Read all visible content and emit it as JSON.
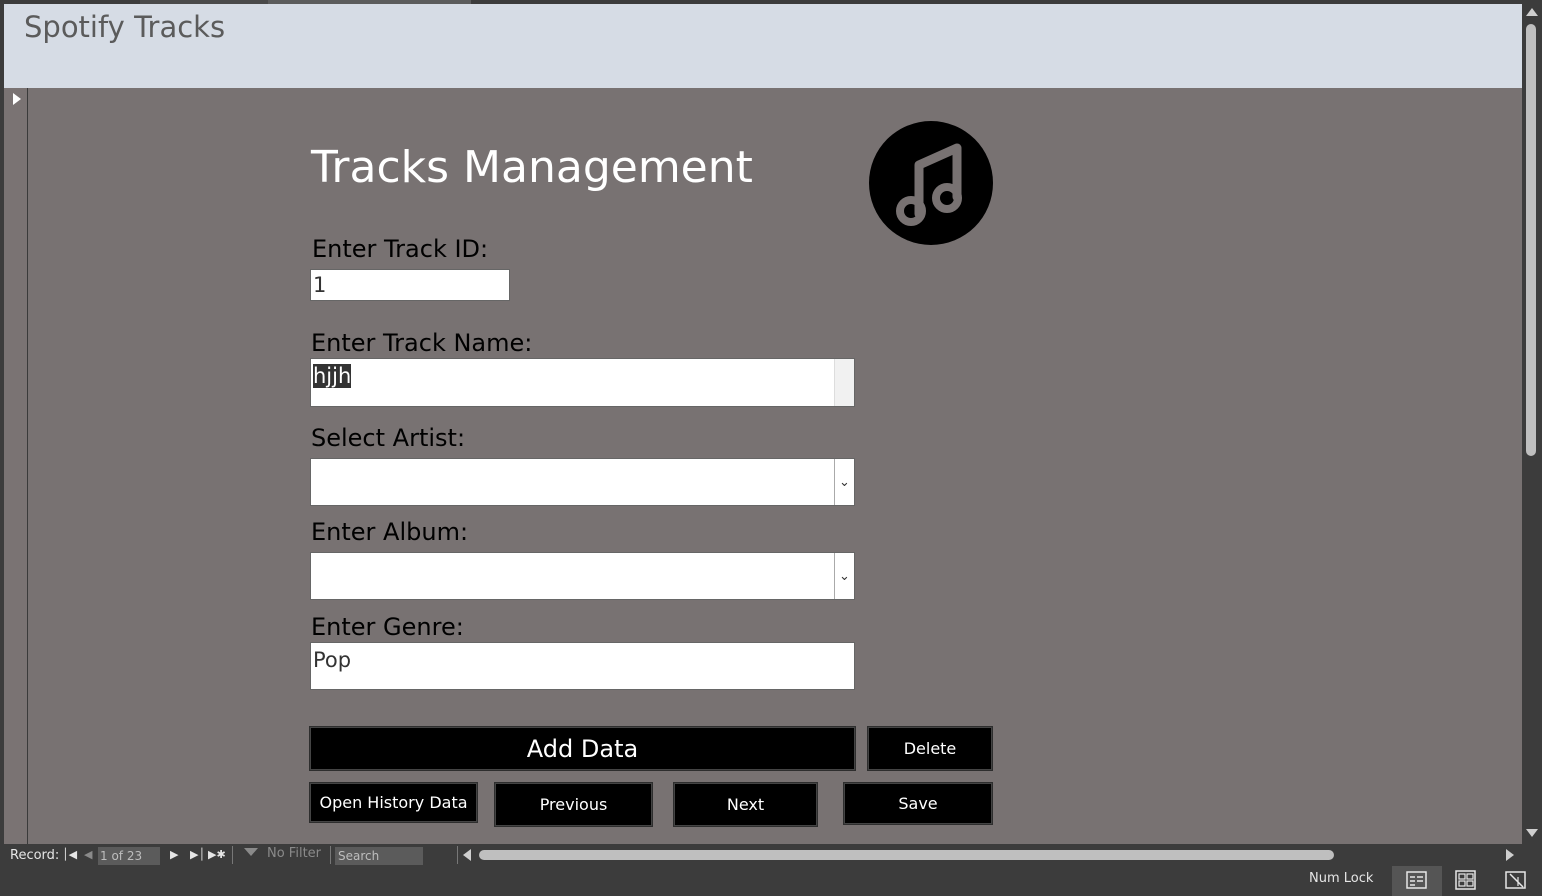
{
  "header": {
    "title": "Spotify Tracks"
  },
  "form": {
    "heading": "Tracks Management",
    "logo_icon": "music-note-icon",
    "track_id": {
      "label": "Enter Track ID:",
      "value": "1"
    },
    "track_name": {
      "label": "Enter Track Name:",
      "value": "hjjh"
    },
    "artist": {
      "label": "Select Artist:",
      "value": ""
    },
    "album": {
      "label": "Enter Album:",
      "value": ""
    },
    "genre": {
      "label": "Enter Genre:",
      "value": "Pop"
    }
  },
  "buttons": {
    "add": "Add Data",
    "delete": "Delete",
    "history": "Open History Data",
    "previous": "Previous",
    "next": "Next",
    "save": "Save"
  },
  "navbar": {
    "record_label": "Record:",
    "record_position": "1 of 23",
    "filter": "No Filter",
    "search_placeholder": "Search"
  },
  "statusbar": {
    "numlock": "Num Lock"
  },
  "colors": {
    "header_bg": "#d6dce5",
    "detail_bg": "#787272",
    "button_bg": "#000000",
    "chrome_bg": "#3c3c3c"
  }
}
